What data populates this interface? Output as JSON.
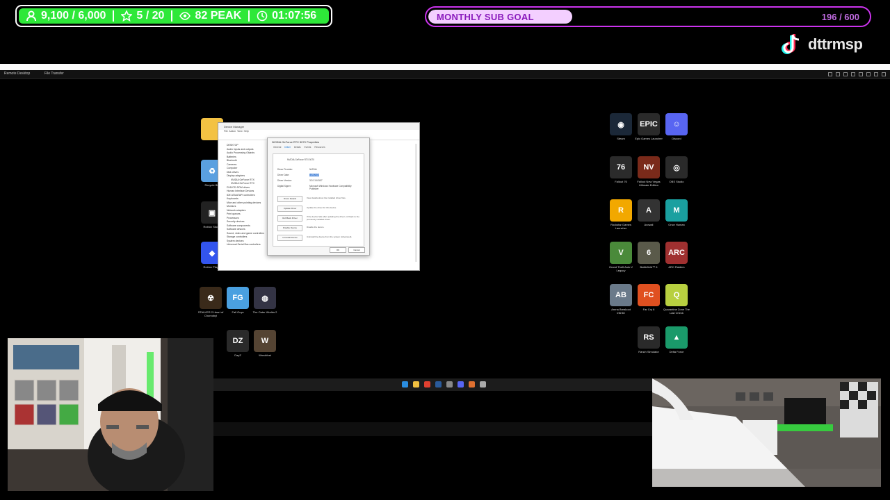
{
  "overlay": {
    "stats": {
      "followers": "9,100 / 6,000",
      "stars": "5 / 20",
      "viewers": "82 PEAK",
      "timer": "01:07:56",
      "accent": "#2ee839"
    },
    "sub_goal": {
      "label": "MONTHLY SUB GOAL",
      "count": "196 / 600",
      "progress": 0.327,
      "accent": "#cc33ee"
    },
    "tiktok_handle": "dttrmsp"
  },
  "remote_desktop": {
    "tabs": [
      "Remote Desktop",
      "File Transfer"
    ]
  },
  "desktop": {
    "left_icons": [
      "Recycle Bin",
      "Roblox Studio",
      "Roblox Player",
      "STALKER 2 Heart of Chornobyl",
      "Fall Guys",
      "The Outer Worlds 2",
      "DayZ",
      "Wreckfest"
    ],
    "right_icons": [
      {
        "label": "Steam",
        "glyph": "◉",
        "color": "#1b2838"
      },
      {
        "label": "Epic Games Launcher",
        "glyph": "EPIC",
        "color": "#2a2a2a"
      },
      {
        "label": "Discord",
        "glyph": "☺",
        "color": "#5865f2"
      },
      {
        "label": "Fallout 76",
        "glyph": "76",
        "color": "#2b2b2b"
      },
      {
        "label": "Fallout New Vegas Ultimate Edition",
        "glyph": "NV",
        "color": "#7a2a1a"
      },
      {
        "label": "OBS Studio",
        "glyph": "◎",
        "color": "#2a2a2a"
      },
      {
        "label": "Rockstar Games Launcher",
        "glyph": "R",
        "color": "#f2a800"
      },
      {
        "label": "Arcwall",
        "glyph": "A",
        "color": "#333"
      },
      {
        "label": "Once Human",
        "glyph": "M",
        "color": "#1aa0a0"
      },
      {
        "label": "Grand Theft Auto V Legacy",
        "glyph": "V",
        "color": "#4a8a3a"
      },
      {
        "label": "Battlefield™ 6",
        "glyph": "6",
        "color": "#5a5a4a"
      },
      {
        "label": "ARC Raiders",
        "glyph": "ARC",
        "color": "#a03030"
      },
      {
        "label": "Arena Breakout Infinite",
        "glyph": "AB",
        "color": "#6a7a8a"
      },
      {
        "label": "Far Cry 6",
        "glyph": "FC",
        "color": "#e05020"
      },
      {
        "label": "Quarantine Zone The Last Check",
        "glyph": "Q",
        "color": "#b8d040"
      },
      {
        "label": "Ranch Simulator",
        "glyph": "RS",
        "color": "#2a2a2a"
      },
      {
        "label": "Delta Force",
        "glyph": "▲",
        "color": "#1a9a6a"
      }
    ]
  },
  "device_manager": {
    "title": "Device Manager",
    "menu": [
      "File",
      "Action",
      "View",
      "Help"
    ],
    "tree": [
      "DESKTOP",
      "Audio inputs and outputs",
      "Audio Processing Objects",
      "Batteries",
      "Bluetooth",
      "Cameras",
      "Computer",
      "Disk drives",
      "Display adapters",
      "NVIDIA GeForce RTX",
      "NVIDIA GeForce RTX",
      "DVD/CD-ROM drives",
      "Human Interface Devices",
      "IDE ATA/ATAPI controllers",
      "Keyboards",
      "Mice and other pointing devices",
      "Monitors",
      "Network adapters",
      "Print queues",
      "Processors",
      "Security devices",
      "Software components",
      "Software devices",
      "Sound, video and game controllers",
      "Storage controllers",
      "System devices",
      "Universal Serial Bus controllers"
    ]
  },
  "properties": {
    "title": "NVIDIA GeForce RTX 5070 Properties",
    "tabs": [
      "General",
      "Driver",
      "Details",
      "Events",
      "Resources"
    ],
    "device_name": "NVIDIA GeForce RTX 5070",
    "fields": [
      {
        "k": "Driver Provider:",
        "v": "NVIDIA"
      },
      {
        "k": "Driver Date:",
        "v": "10/8/2025"
      },
      {
        "k": "Driver Version:",
        "v": "32.0.15.8157"
      },
      {
        "k": "Digital Signer:",
        "v": "Microsoft Windows Hardware Compatibility Publisher"
      }
    ],
    "buttons": [
      {
        "label": "Driver Details",
        "desc": "View details about the installed driver files."
      },
      {
        "label": "Update Driver",
        "desc": "Update the driver for this device."
      },
      {
        "label": "Roll Back Driver",
        "desc": "If the device fails after updating the driver, roll back to the previously installed driver."
      },
      {
        "label": "Disable Device",
        "desc": "Disable the device."
      },
      {
        "label": "Uninstall Device",
        "desc": "Uninstall the device from the system (Advanced)."
      }
    ],
    "ok": "OK",
    "cancel": "Cancel"
  },
  "taskbar": {
    "apps": [
      "windows",
      "explorer",
      "chrome",
      "steam",
      "settings",
      "discord",
      "obs",
      "remote"
    ]
  }
}
